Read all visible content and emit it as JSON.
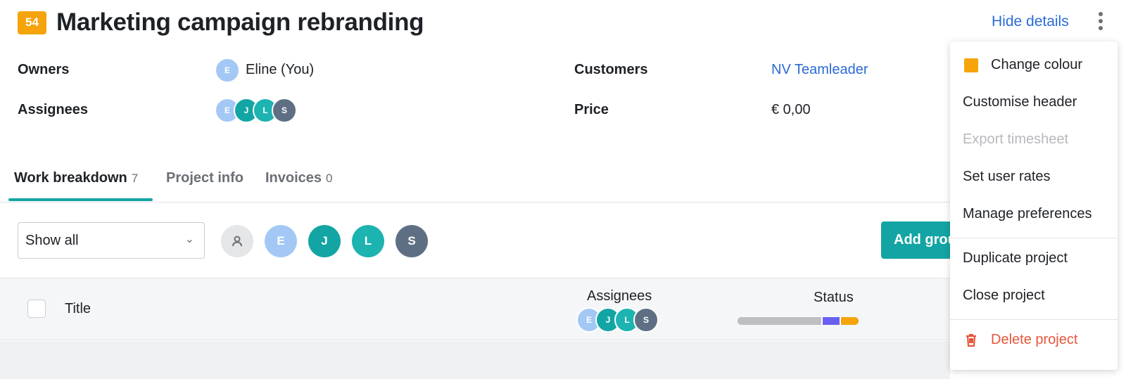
{
  "header": {
    "project_number": "54",
    "title": "Marketing campaign rebranding",
    "hide_details_label": "Hide details",
    "accent_color": "#f5a40c"
  },
  "details": {
    "owners_label": "Owners",
    "owner_initial": "E",
    "owner_name": "Eline (You)",
    "assignees_label": "Assignees",
    "assignees": [
      "E",
      "J",
      "L",
      "S"
    ],
    "customers_label": "Customers",
    "customer_name": "NV Teamleader",
    "price_label": "Price",
    "price_value": "€ 0,00"
  },
  "tabs": [
    {
      "label": "Work breakdown",
      "count": "7",
      "active": true
    },
    {
      "label": "Project info",
      "count": "",
      "active": false
    },
    {
      "label": "Invoices",
      "count": "0",
      "active": false
    }
  ],
  "filters": {
    "select_value": "Show all",
    "user_avatars": [
      "E",
      "J",
      "L",
      "S"
    ],
    "add_group_label": "Add group"
  },
  "table": {
    "col_title": "Title",
    "col_assignees": "Assignees",
    "col_status": "Status",
    "assignees": [
      "E",
      "J",
      "L",
      "S"
    ],
    "status_colors": [
      "#bdbfc3",
      "#6a5ff0",
      "#f5a40c"
    ]
  },
  "menu": {
    "change_colour": "Change colour",
    "customise_header": "Customise header",
    "export_timesheet": "Export timesheet",
    "set_user_rates": "Set user rates",
    "manage_preferences": "Manage preferences",
    "duplicate_project": "Duplicate project",
    "close_project": "Close project",
    "delete_project": "Delete project",
    "danger_color": "#e5573b"
  }
}
